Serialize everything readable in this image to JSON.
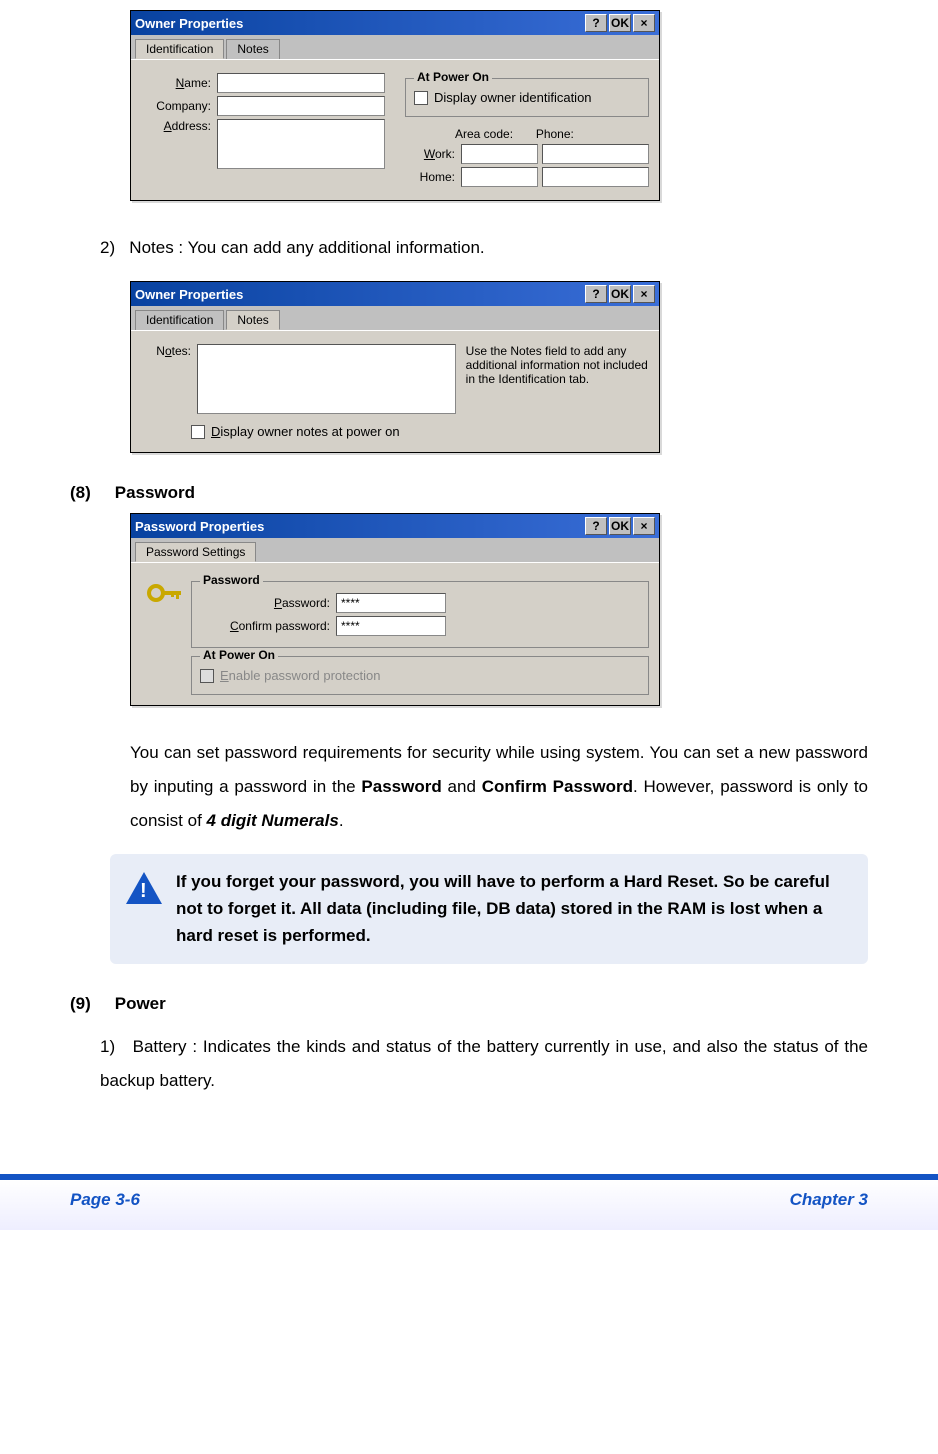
{
  "dialog1": {
    "title": "Owner Properties",
    "help": "?",
    "ok": "OK",
    "close": "×",
    "tabs": [
      "Identification",
      "Notes"
    ],
    "name_label": "Name:",
    "company_label": "Company:",
    "address_label": "Address:",
    "poweron_legend": "At Power On",
    "display_owner_id": "Display owner identification",
    "areacode_label": "Area code:",
    "phone_label": "Phone:",
    "work_label": "Work:",
    "home_label": "Home:"
  },
  "step2": {
    "num": "2)",
    "text": "Notes : You can add any additional information."
  },
  "dialog2": {
    "title": "Owner Properties",
    "help": "?",
    "ok": "OK",
    "close": "×",
    "tabs": [
      "Identification",
      "Notes"
    ],
    "notes_label": "Notes:",
    "hint": "Use the Notes field to add any additional information not included in the Identification tab.",
    "display_notes": "Display owner notes at power on"
  },
  "sec8": {
    "num": "(8)",
    "title": "Password"
  },
  "dialog3": {
    "title": "Password Properties",
    "help": "?",
    "ok": "OK",
    "close": "×",
    "tab": "Password Settings",
    "pw_legend": "Password",
    "pw_label": "Password:",
    "pw_val": "****",
    "cpw_label": "Confirm password:",
    "cpw_val": "****",
    "poweron_legend": "At Power On",
    "enable_pw": "Enable password protection"
  },
  "pw_desc_a": "You can set password requirements for security while using system. You can set a new password by inputing a password in the ",
  "pw_desc_b": "Password",
  "pw_desc_c": " and ",
  "pw_desc_d": "Confirm Password",
  "pw_desc_e": ". However, password is only to consist of ",
  "pw_desc_f": "4 digit Numerals",
  "pw_desc_g": ".",
  "warning": "If you forget your password, you will have to perform a Hard Reset. So be careful not to forget it. All data (including file, DB data) stored in the RAM is lost when a hard reset is performed.",
  "sec9": {
    "num": "(9)",
    "title": "Power",
    "item_num": "1)",
    "item_text": "Battery : Indicates the kinds and status of the battery currently in use, and also the status of the backup battery."
  },
  "footer": {
    "left": "Page 3-6",
    "right": "Chapter 3"
  }
}
